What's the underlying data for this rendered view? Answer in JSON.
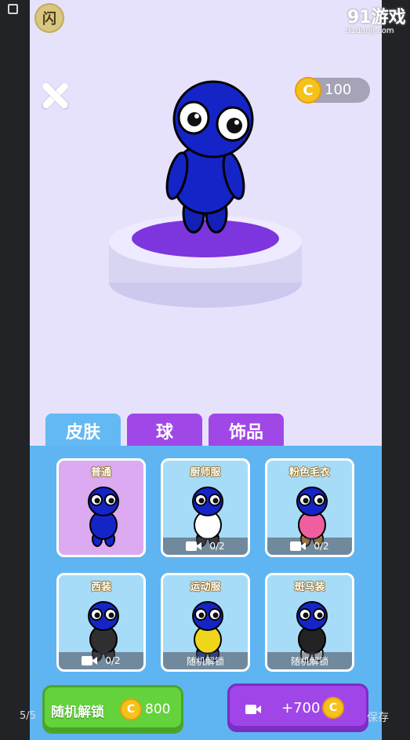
{
  "overlay": {
    "left_icon": "app-square-icon",
    "badge_text": "闪",
    "watermark_text": "91游戏",
    "watermark_sub": "91danji.com"
  },
  "top": {
    "close_icon": "close-icon",
    "coins": "100",
    "coin_symbol": "C"
  },
  "tabs": [
    {
      "label": "皮肤",
      "active": true
    },
    {
      "label": "球",
      "active": false
    },
    {
      "label": "饰品",
      "active": false
    }
  ],
  "skins": [
    {
      "name": "普通",
      "footer": "",
      "selected": true,
      "shirt": "#1524c7",
      "pants": "#1524c7"
    },
    {
      "name": "厨师服",
      "footer": "0/2",
      "footer_type": "video",
      "selected": false,
      "shirt": "#ffffff",
      "pants": "#2b2b2b"
    },
    {
      "name": "粉色毛衣",
      "footer": "0/2",
      "footer_type": "video",
      "selected": false,
      "shirt": "#ee5ea0",
      "pants": "#f4a42a"
    },
    {
      "name": "西装",
      "footer": "0/2",
      "footer_type": "video",
      "selected": false,
      "shirt": "#2f2f2f",
      "pants": "#2f2f2f"
    },
    {
      "name": "运动服",
      "footer": "随机解锁",
      "footer_type": "text",
      "selected": false,
      "shirt": "#f0d61b",
      "pants": "#1b3eb8"
    },
    {
      "name": "斑马装",
      "footer": "随机解锁",
      "footer_type": "text",
      "selected": false,
      "shirt": "#222222",
      "pants": "#ffffff"
    }
  ],
  "buttons": {
    "random_unlock_label": "随机解锁",
    "random_unlock_price": "800",
    "video_reward": "+700",
    "coin_symbol": "C"
  },
  "footer": {
    "page_count": "5/5",
    "save_label": "保存"
  },
  "colors": {
    "background": "#e6e2fb",
    "panel": "#5fb5f2",
    "tab_inactive": "#a047e8",
    "character": "#1524c7",
    "button_green": "#63d23b",
    "button_purple": "#a046e8",
    "coin": "#f5c21b"
  }
}
